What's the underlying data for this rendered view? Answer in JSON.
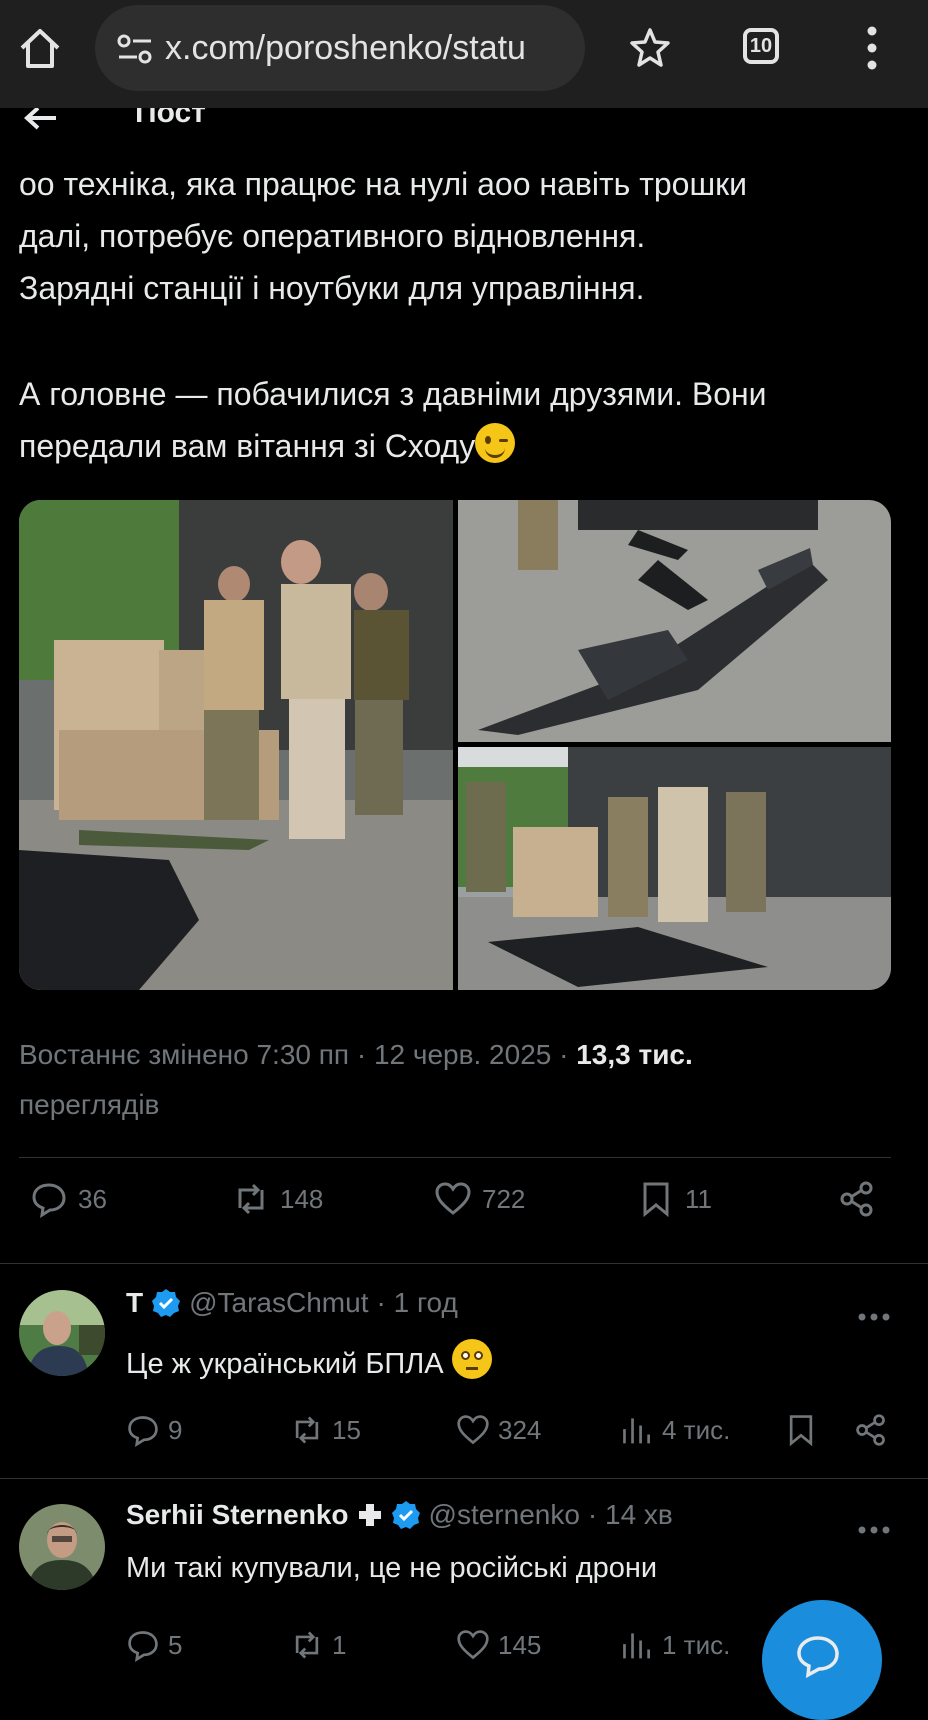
{
  "browser": {
    "url": "x.com/poroshenko/statu",
    "tab_count": "10"
  },
  "header": {
    "title": "Пост"
  },
  "post": {
    "lines": [
      "оо техніка, яка працює на нулі аоо навіть трошки",
      "далі, потребує оперативного відновлення.",
      "Зарядні станції і ноутбуки для управління.",
      "А головне — побачилися з давніми друзями. Вони",
      "передали вам вітання зі Сходу"
    ],
    "meta_prefix": "Востаннє змінено 7:30 пп · 12 черв. 2025 · ",
    "views_count": "13,3 тис.",
    "views_label": "переглядів",
    "stats": {
      "replies": "36",
      "reposts": "148",
      "likes": "722",
      "bookmarks": "11"
    }
  },
  "replies": [
    {
      "name": "T",
      "handle": "@TarasChmut",
      "time": "· 1 год",
      "text": "Це ж український БПЛА",
      "replies": "9",
      "reposts": "15",
      "likes": "324",
      "views": "4 тис."
    },
    {
      "name": "Serhii Sternenko",
      "handle": "@sternenko",
      "time": "· 14 хв",
      "text": "Ми такі купували, це не російські дрони",
      "replies": "5",
      "reposts": "1",
      "likes": "145",
      "views": "1 тис."
    }
  ],
  "colors": {
    "accent": "#1d9bf0",
    "muted": "#71767b",
    "text": "#e7e9ea",
    "background": "#000000"
  }
}
